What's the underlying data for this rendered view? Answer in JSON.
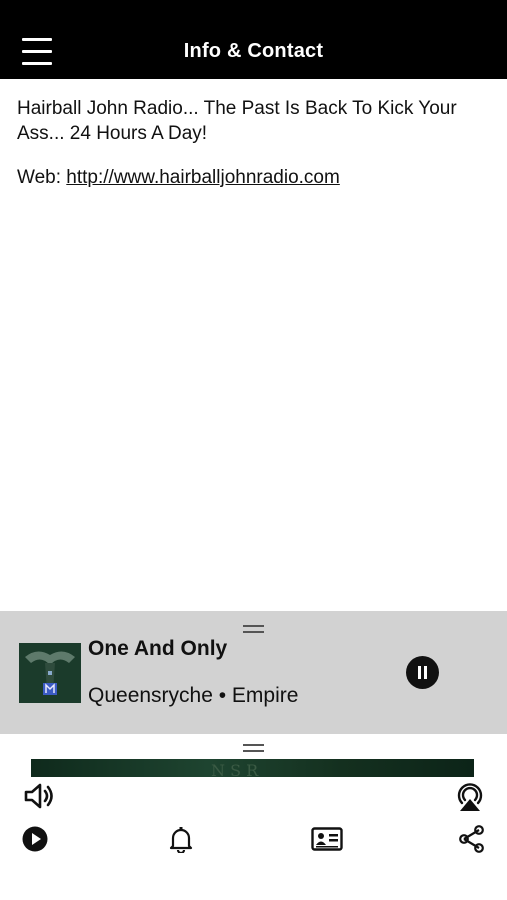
{
  "header": {
    "title": "Info & Contact"
  },
  "content": {
    "description": "Hairball John Radio... The Past Is Back To Kick Your Ass... 24 Hours A Day!",
    "web_label": "Web:",
    "web_url": "http://www.hairballjohnradio.com"
  },
  "now_playing": {
    "title": "One And Only",
    "subtitle": "Queensryche • Empire",
    "is_playing": true
  },
  "toolbar": {
    "icons": [
      "volume-icon",
      "airplay-icon",
      "play-icon",
      "bell-icon",
      "contact-card-icon",
      "share-icon"
    ]
  },
  "colors": {
    "header_bg": "#000000",
    "player_bg": "#d2d2d2",
    "text": "#111111"
  }
}
